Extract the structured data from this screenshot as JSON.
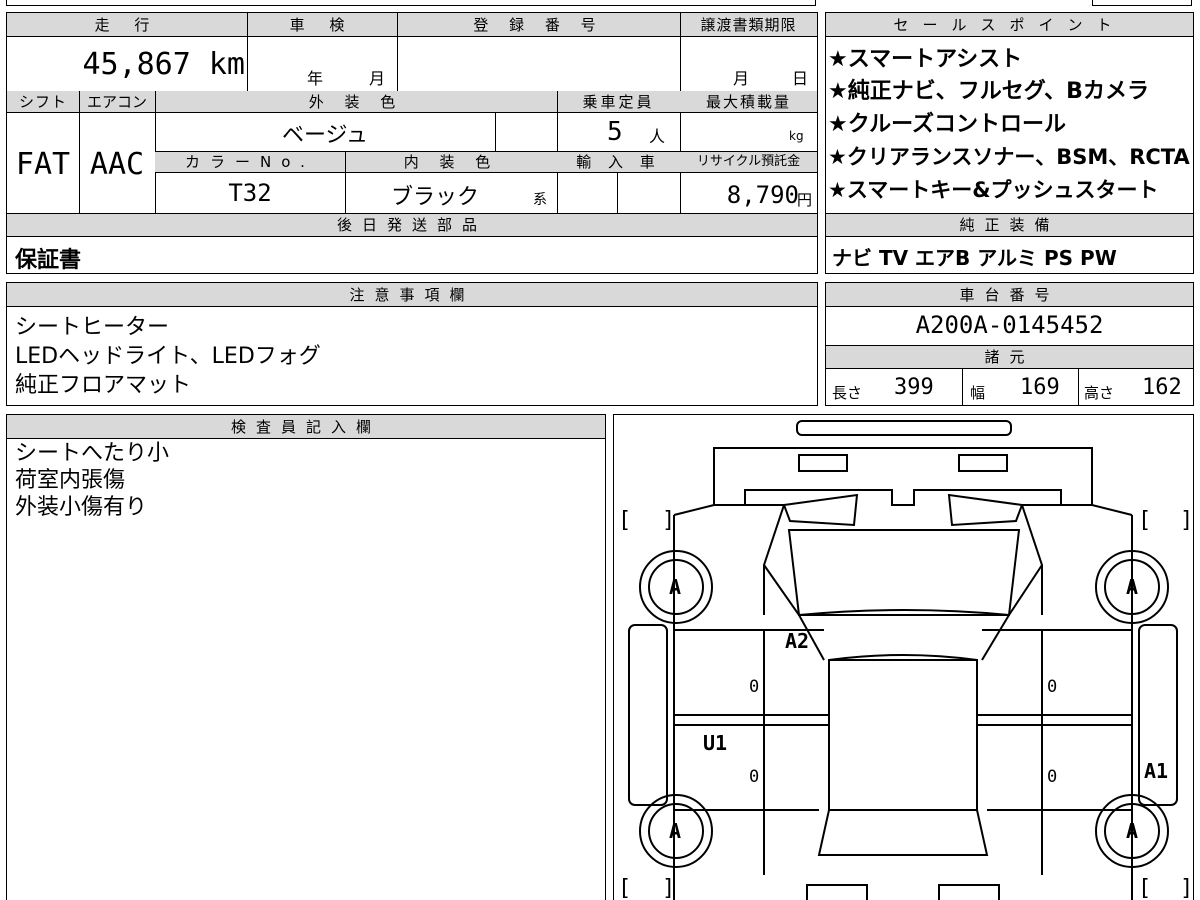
{
  "vehicle": {
    "mileage_label": "走 行",
    "mileage_value": "45,867 km",
    "inspection_label": "車 検",
    "inspection_year": "年",
    "inspection_month": "月",
    "registration_label": "登 録 番 号",
    "transfer_label": "譲渡書類期限",
    "transfer_month": "月",
    "transfer_day": "日",
    "shift_label": "シフト",
    "shift_value": "FAT",
    "aircon_label": "エアコン",
    "aircon_value": "AAC",
    "exterior_label": "外 装 色",
    "exterior_value": "ベージュ",
    "color_no_label": "カラーNo.",
    "color_no_value": "T32",
    "interior_label": "内 装 色",
    "interior_value": "ブラック",
    "interior_suffix": "系",
    "capacity_label": "乗車定員",
    "capacity_value": "5",
    "capacity_unit": "人",
    "import_label": "輸 入 車",
    "max_load_label": "最大積載量",
    "max_load_unit": "kg",
    "recycle_label": "リサイクル預託金",
    "recycle_value": "8,790",
    "recycle_unit": "円"
  },
  "sales_points": {
    "header": "セールスポイント",
    "items": [
      "★スマートアシスト",
      "★純正ナビ、フルセグ、Bカメラ",
      "★クルーズコントロール",
      "★クリアランスソナー、BSM、RCTA",
      "★スマートキー&プッシュスタート"
    ]
  },
  "later_parts": {
    "header": "後日発送部品",
    "value": "保証書"
  },
  "genuine_equipment": {
    "header": "純正装備",
    "value": "ナビ TV エアB アルミ PS PW"
  },
  "notes": {
    "header": "注意事項欄",
    "lines": [
      "シートヒーター",
      "LEDヘッドライト、LEDフォグ",
      "純正フロアマット"
    ]
  },
  "chassis": {
    "header": "車台番号",
    "value": "A200A-0145452"
  },
  "specs": {
    "header": "諸元",
    "length_label": "長さ",
    "length_value": "399",
    "width_label": "幅",
    "width_value": "169",
    "height_label": "高さ",
    "height_value": "162"
  },
  "inspector": {
    "header": "検査員記入欄",
    "lines": [
      "シートへたり小",
      "荷室内張傷",
      "外装小傷有り"
    ]
  },
  "diagram": {
    "marks": [
      "A",
      "A",
      "A",
      "A",
      "A2",
      "U1",
      "A1"
    ],
    "zeros": [
      "0",
      "0",
      "0",
      "0"
    ]
  }
}
